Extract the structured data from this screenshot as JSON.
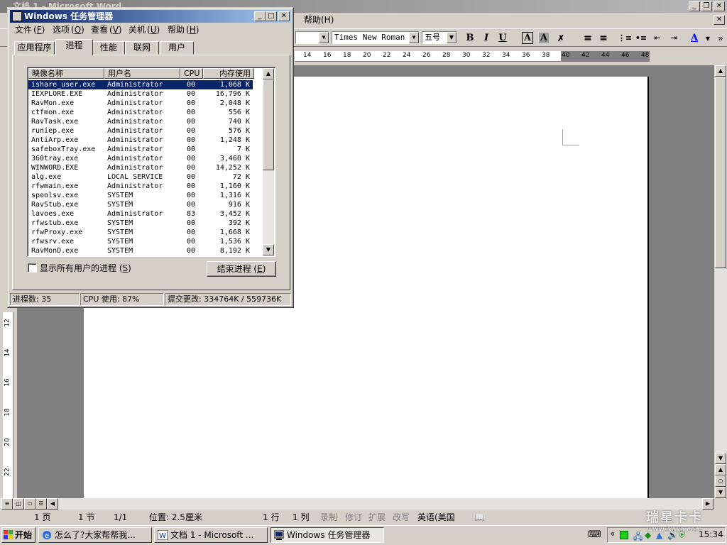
{
  "word": {
    "title": "文档 1 - Microsoft Word",
    "menu_help": "帮助(H)",
    "font_name": "Times New Roman",
    "font_size": "五号",
    "ruler_numbers": [
      "14",
      "16",
      "18",
      "20",
      "22",
      "24",
      "26",
      "28",
      "30",
      "32",
      "34",
      "36",
      "38",
      "40",
      "42",
      "44",
      "46",
      "48"
    ],
    "vruler_numbers": [
      "12",
      "14",
      "16",
      "18",
      "20",
      "22"
    ],
    "status": {
      "page": "1 页",
      "section": "1 节",
      "pages": "1/1",
      "position": "位置: 2.5厘米",
      "line": "1 行",
      "column": "1 列",
      "rec": "录制",
      "trk": "修订",
      "ext": "扩展",
      "ovr": "改写",
      "language": "英语(美国"
    }
  },
  "taskmgr": {
    "title": "Windows 任务管理器",
    "menu": [
      {
        "label": "文件",
        "key": "F"
      },
      {
        "label": "选项",
        "key": "O"
      },
      {
        "label": "查看",
        "key": "V"
      },
      {
        "label": "关机",
        "key": "U"
      },
      {
        "label": "帮助",
        "key": "H"
      }
    ],
    "tabs": [
      "应用程序",
      "进程",
      "性能",
      "联网",
      "用户"
    ],
    "active_tab": "进程",
    "columns": [
      "映像名称",
      "用户名",
      "CPU",
      "内存使用"
    ],
    "processes": [
      {
        "name": "ishare_user.exe",
        "user": "Administrator",
        "cpu": "00",
        "mem": "1,068 K",
        "selected": true
      },
      {
        "name": "IEXPLORE.EXE",
        "user": "Administrator",
        "cpu": "00",
        "mem": "16,796 K"
      },
      {
        "name": "RavMon.exe",
        "user": "Administrator",
        "cpu": "00",
        "mem": "2,048 K"
      },
      {
        "name": "ctfmon.exe",
        "user": "Administrator",
        "cpu": "00",
        "mem": "556 K"
      },
      {
        "name": "RavTask.exe",
        "user": "Administrator",
        "cpu": "00",
        "mem": "740 K"
      },
      {
        "name": "runiep.exe",
        "user": "Administrator",
        "cpu": "00",
        "mem": "576 K"
      },
      {
        "name": "AntiArp.exe",
        "user": "Administrator",
        "cpu": "00",
        "mem": "1,248 K"
      },
      {
        "name": "safeboxTray.exe",
        "user": "Administrator",
        "cpu": "00",
        "mem": "7 K"
      },
      {
        "name": "360tray.exe",
        "user": "Administrator",
        "cpu": "00",
        "mem": "3,460 K"
      },
      {
        "name": "WINWORD.EXE",
        "user": "Administrator",
        "cpu": "00",
        "mem": "14,252 K"
      },
      {
        "name": "alg.exe",
        "user": "LOCAL SERVICE",
        "cpu": "00",
        "mem": "72 K"
      },
      {
        "name": "rfwmain.exe",
        "user": "Administrator",
        "cpu": "00",
        "mem": "1,160 K"
      },
      {
        "name": "spoolsv.exe",
        "user": "SYSTEM",
        "cpu": "00",
        "mem": "1,316 K"
      },
      {
        "name": "RavStub.exe",
        "user": "SYSTEM",
        "cpu": "00",
        "mem": "916 K"
      },
      {
        "name": "lavoes.exe",
        "user": "Administrator",
        "cpu": "83",
        "mem": "3,452 K"
      },
      {
        "name": "rfwstub.exe",
        "user": "SYSTEM",
        "cpu": "00",
        "mem": "392 K"
      },
      {
        "name": "rfwProxy.exe",
        "user": "SYSTEM",
        "cpu": "00",
        "mem": "1,668 K"
      },
      {
        "name": "rfwsrv.exe",
        "user": "SYSTEM",
        "cpu": "00",
        "mem": "1,536 K"
      },
      {
        "name": "RavMonD.exe",
        "user": "SYSTEM",
        "cpu": "00",
        "mem": "8,192 K"
      }
    ],
    "show_all_users_label": "显示所有用户的进程",
    "show_all_users_key": "S",
    "end_process_label": "结束进程",
    "end_process_key": "E",
    "status_processes": "进程数: 35",
    "status_cpu": "CPU 使用: 87%",
    "status_commit": "提交更改: 334764K / 559736K"
  },
  "taskbar": {
    "start_label": "开始",
    "tasks": [
      {
        "label": "怎么了?大家帮帮我..."
      },
      {
        "label": "文档 1 - Microsoft ..."
      },
      {
        "label": "Windows 任务管理器"
      }
    ],
    "clock": "15:34",
    "watermark": "瑞星卡卡",
    "watermark_url": "www.ikaka.com"
  }
}
